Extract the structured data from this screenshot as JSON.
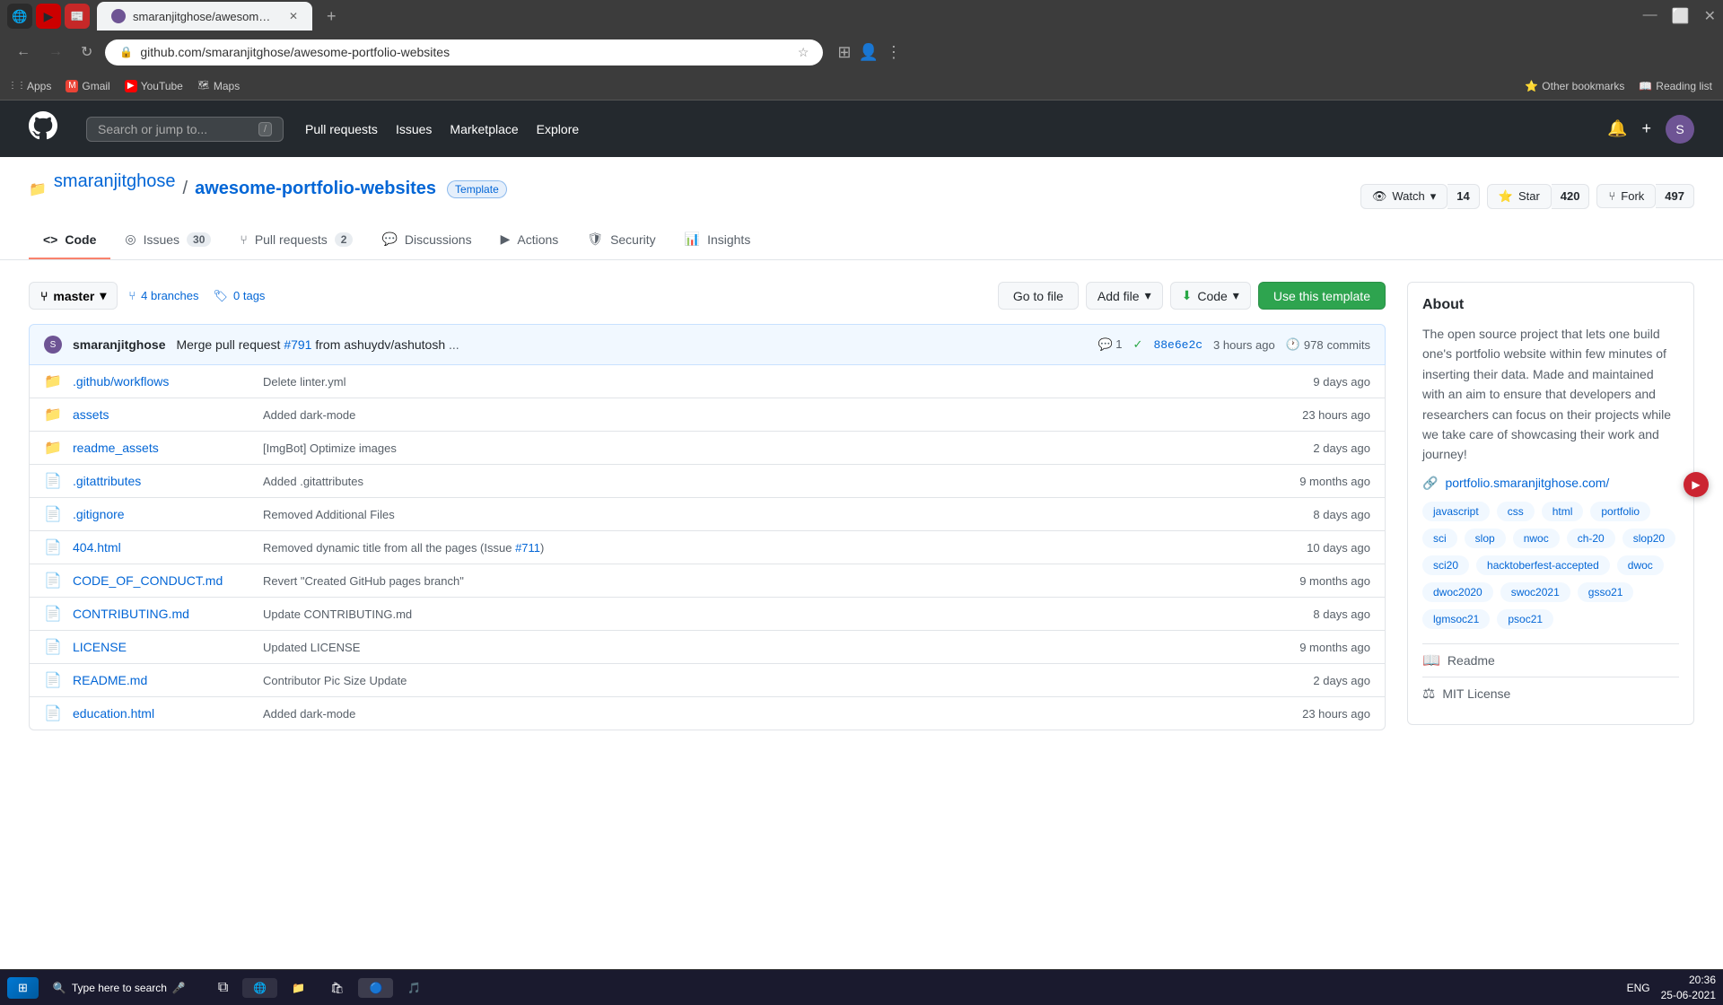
{
  "browser": {
    "tab_favicon": "🐱",
    "tab_title": "smaranjitghose/awesome-portfo...",
    "tab_new": "+",
    "address": "github.com/smaranjitghose/awesome-portfolio-websites",
    "bookmarks": [
      {
        "id": "apps",
        "icon": "⋮⋮",
        "label": "Apps"
      },
      {
        "id": "gmail",
        "icon": "M",
        "label": "Gmail"
      },
      {
        "id": "youtube",
        "icon": "▶",
        "label": "YouTube"
      },
      {
        "id": "maps",
        "icon": "📍",
        "label": "Maps"
      },
      {
        "id": "other",
        "icon": "⭐",
        "label": "Other bookmarks"
      },
      {
        "id": "reading",
        "icon": "📖",
        "label": "Reading list"
      }
    ]
  },
  "github": {
    "nav": {
      "search_placeholder": "Search or jump to...",
      "search_kbd": "/",
      "pull_requests": "Pull requests",
      "issues": "Issues",
      "marketplace": "Marketplace",
      "explore": "Explore"
    },
    "repo": {
      "owner": "smaranjitghose",
      "name": "awesome-portfolio-websites",
      "badge": "Template",
      "watch_label": "Watch",
      "watch_count": "14",
      "star_label": "Star",
      "star_count": "420",
      "fork_label": "Fork",
      "fork_count": "497"
    },
    "tabs": [
      {
        "id": "code",
        "icon": "<>",
        "label": "Code",
        "active": true,
        "count": null
      },
      {
        "id": "issues",
        "icon": "◎",
        "label": "Issues",
        "count": "30"
      },
      {
        "id": "pull-requests",
        "icon": "⑂",
        "label": "Pull requests",
        "count": "2"
      },
      {
        "id": "discussions",
        "icon": "💬",
        "label": "Discussions",
        "count": null
      },
      {
        "id": "actions",
        "icon": "▶",
        "label": "Actions",
        "count": null
      },
      {
        "id": "security",
        "icon": "🛡",
        "label": "Security",
        "count": null
      },
      {
        "id": "insights",
        "icon": "📊",
        "label": "Insights",
        "count": null
      }
    ],
    "branch": {
      "current": "master",
      "branches_count": "4 branches",
      "tags_count": "0 tags",
      "go_to_file": "Go to file",
      "add_file": "Add file",
      "code_label": "Code",
      "use_template": "Use this template"
    },
    "commit": {
      "author": "smaranjitghose",
      "message": "Merge pull request",
      "pr_number": "#791",
      "pr_suffix": "from ashuydv/ashutosh",
      "ellipsis": "...",
      "comments": "1",
      "check": "✓",
      "hash": "88e6e2c",
      "time": "3 hours ago",
      "history_icon": "🕐",
      "commits_count": "978",
      "commits_label": "commits"
    },
    "files": [
      {
        "type": "dir",
        "name": ".github/workflows",
        "commit_msg": "Delete linter.yml",
        "time": "9 days ago"
      },
      {
        "type": "dir",
        "name": "assets",
        "commit_msg": "Added dark-mode",
        "time": "23 hours ago"
      },
      {
        "type": "dir",
        "name": "readme_assets",
        "commit_msg": "[ImgBot] Optimize images",
        "time": "2 days ago"
      },
      {
        "type": "file",
        "name": ".gitattributes",
        "commit_msg": "Added .gitattributes",
        "time": "9 months ago"
      },
      {
        "type": "file",
        "name": ".gitignore",
        "commit_msg": "Removed Additional Files",
        "time": "8 days ago"
      },
      {
        "type": "file",
        "name": "404.html",
        "commit_msg": "Removed dynamic title from all the pages (Issue #711)",
        "time": "10 days ago"
      },
      {
        "type": "file",
        "name": "CODE_OF_CONDUCT.md",
        "commit_msg": "Revert \"Created GitHub pages branch\"",
        "time": "9 months ago"
      },
      {
        "type": "file",
        "name": "CONTRIBUTING.md",
        "commit_msg": "Update CONTRIBUTING.md",
        "time": "8 days ago"
      },
      {
        "type": "file",
        "name": "LICENSE",
        "commit_msg": "Updated LICENSE",
        "time": "9 months ago"
      },
      {
        "type": "file",
        "name": "README.md",
        "commit_msg": "Contributor Pic Size Update",
        "time": "2 days ago"
      },
      {
        "type": "file",
        "name": "education.html",
        "commit_msg": "Added dark-mode",
        "time": "23 hours ago"
      }
    ],
    "about": {
      "title": "About",
      "description": "The open source project that lets one build one's portfolio website within few minutes of inserting their data. Made and maintained with an aim to ensure that developers and researchers can focus on their projects while we take care of showcasing their work and journey!",
      "website_url": "portfolio.smaranjitghose.com/",
      "website_icon": "🔗",
      "topics": [
        "javascript",
        "css",
        "html",
        "portfolio",
        "sci",
        "slop",
        "nwoc",
        "ch-20",
        "slop20",
        "sci20",
        "hacktoberfest-accepted",
        "dwoc",
        "dwoc2020",
        "swoc2021",
        "gsso21",
        "lgmsoc21",
        "psoc21"
      ],
      "readme_label": "Readme",
      "readme_icon": "📖",
      "license_label": "MIT License",
      "license_icon": "⚖"
    }
  },
  "taskbar": {
    "start_icon": "⊞",
    "start_label": "Start",
    "search_placeholder": "Type here to search",
    "time": "20:36",
    "date": "25-06-2021",
    "lang": "ENG"
  },
  "floating": {
    "icon": "▶"
  }
}
